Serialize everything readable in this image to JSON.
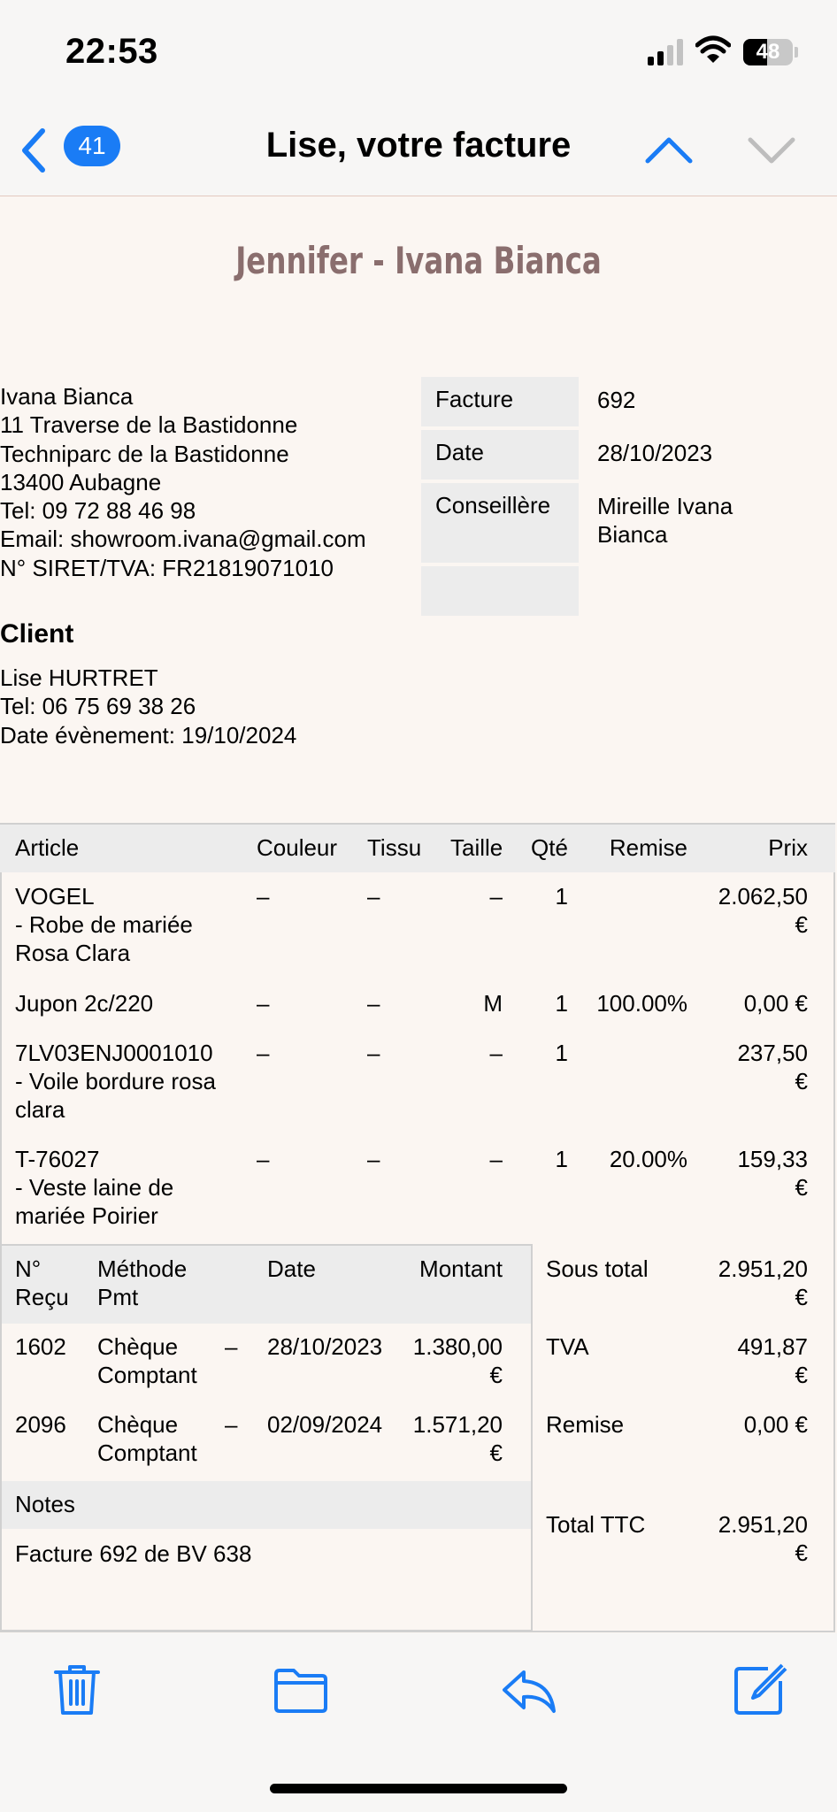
{
  "status_bar": {
    "time": "22:53",
    "battery": "48",
    "battery_level": 0.48
  },
  "nav": {
    "unread_count": "41",
    "title": "Lise, votre facture"
  },
  "document": {
    "heading": "Jennifer - Ivana Bianca",
    "company_lines": [
      "Ivana Bianca",
      "11 Traverse de la Bastidonne",
      "Techniparc de la Bastidonne",
      "13400 Aubagne",
      "Tel: 09 72 88 46 98",
      "Email: showroom.ivana@gmail.com",
      "N° SIRET/TVA: FR21819071010"
    ],
    "meta": [
      {
        "label": "Facture",
        "value": "692"
      },
      {
        "label": "Date",
        "value": "28/10/2023"
      },
      {
        "label": "Conseillère",
        "value_lines": [
          "Mireille Ivana",
          "Bianca"
        ]
      }
    ],
    "client": {
      "heading": "Client",
      "lines": [
        "Lise HURTRET",
        "Tel: 06 75 69 38 26",
        "Date évènement: 19/10/2024"
      ]
    },
    "articles": {
      "columns": [
        "Article",
        "Couleur",
        "Tissu",
        "Taille",
        "Qté",
        "Remise",
        "Prix"
      ],
      "rows": [
        {
          "article": [
            "VOGEL",
            "- Robe de mariée",
            "Rosa Clara"
          ],
          "couleur": "–",
          "tissu": "–",
          "taille": "–",
          "qte": "1",
          "remise": "",
          "prix": [
            "2.062,50",
            "€"
          ]
        },
        {
          "article": [
            "Jupon 2c/220"
          ],
          "couleur": "–",
          "tissu": "–",
          "taille": "M",
          "qte": "1",
          "remise": "100.00%",
          "prix": [
            "0,00 €"
          ]
        },
        {
          "article": [
            "7LV03ENJ0001010",
            "- Voile bordure rosa",
            "clara"
          ],
          "couleur": "–",
          "tissu": "–",
          "taille": "–",
          "qte": "1",
          "remise": "",
          "prix": [
            "237,50",
            "€"
          ]
        },
        {
          "article": [
            "T-76027",
            "- Veste laine de",
            "mariée Poirier"
          ],
          "couleur": "–",
          "tissu": "–",
          "taille": "–",
          "qte": "1",
          "remise": "20.00%",
          "prix": [
            "159,33",
            "€"
          ]
        }
      ]
    },
    "payments": {
      "columns": {
        "recu": [
          "N°",
          "Reçu"
        ],
        "methode": [
          "Méthode",
          "Pmt"
        ],
        "date": "Date",
        "montant": "Montant"
      },
      "rows": [
        {
          "recu": "1602",
          "methode": [
            "Chèque",
            "Comptant"
          ],
          "dash": "–",
          "date": "28/10/2023",
          "montant": [
            "1.380,00",
            "€"
          ]
        },
        {
          "recu": "2096",
          "methode": [
            "Chèque",
            "Comptant"
          ],
          "dash": "–",
          "date": "02/09/2024",
          "montant": [
            "1.571,20",
            "€"
          ]
        }
      ]
    },
    "notes": {
      "heading": "Notes",
      "text": "Facture 692 de BV 638"
    },
    "totals": [
      {
        "label": "Sous total",
        "value": [
          "2.951,20",
          "€"
        ]
      },
      {
        "label": "TVA",
        "value": [
          "491,87",
          "€"
        ]
      },
      {
        "label": "Remise",
        "value": [
          "0,00 €"
        ]
      },
      {
        "label": "Total TTC",
        "value": [
          "2.951,20",
          "€"
        ]
      }
    ]
  },
  "toolbar": {
    "icons": [
      "trash-icon",
      "folder-icon",
      "reply-icon",
      "compose-icon"
    ]
  },
  "colors": {
    "accent": "#1a7cf5",
    "heading": "#8a6e6e",
    "background": "#fbf6f2",
    "header_cells": "#ececec"
  }
}
